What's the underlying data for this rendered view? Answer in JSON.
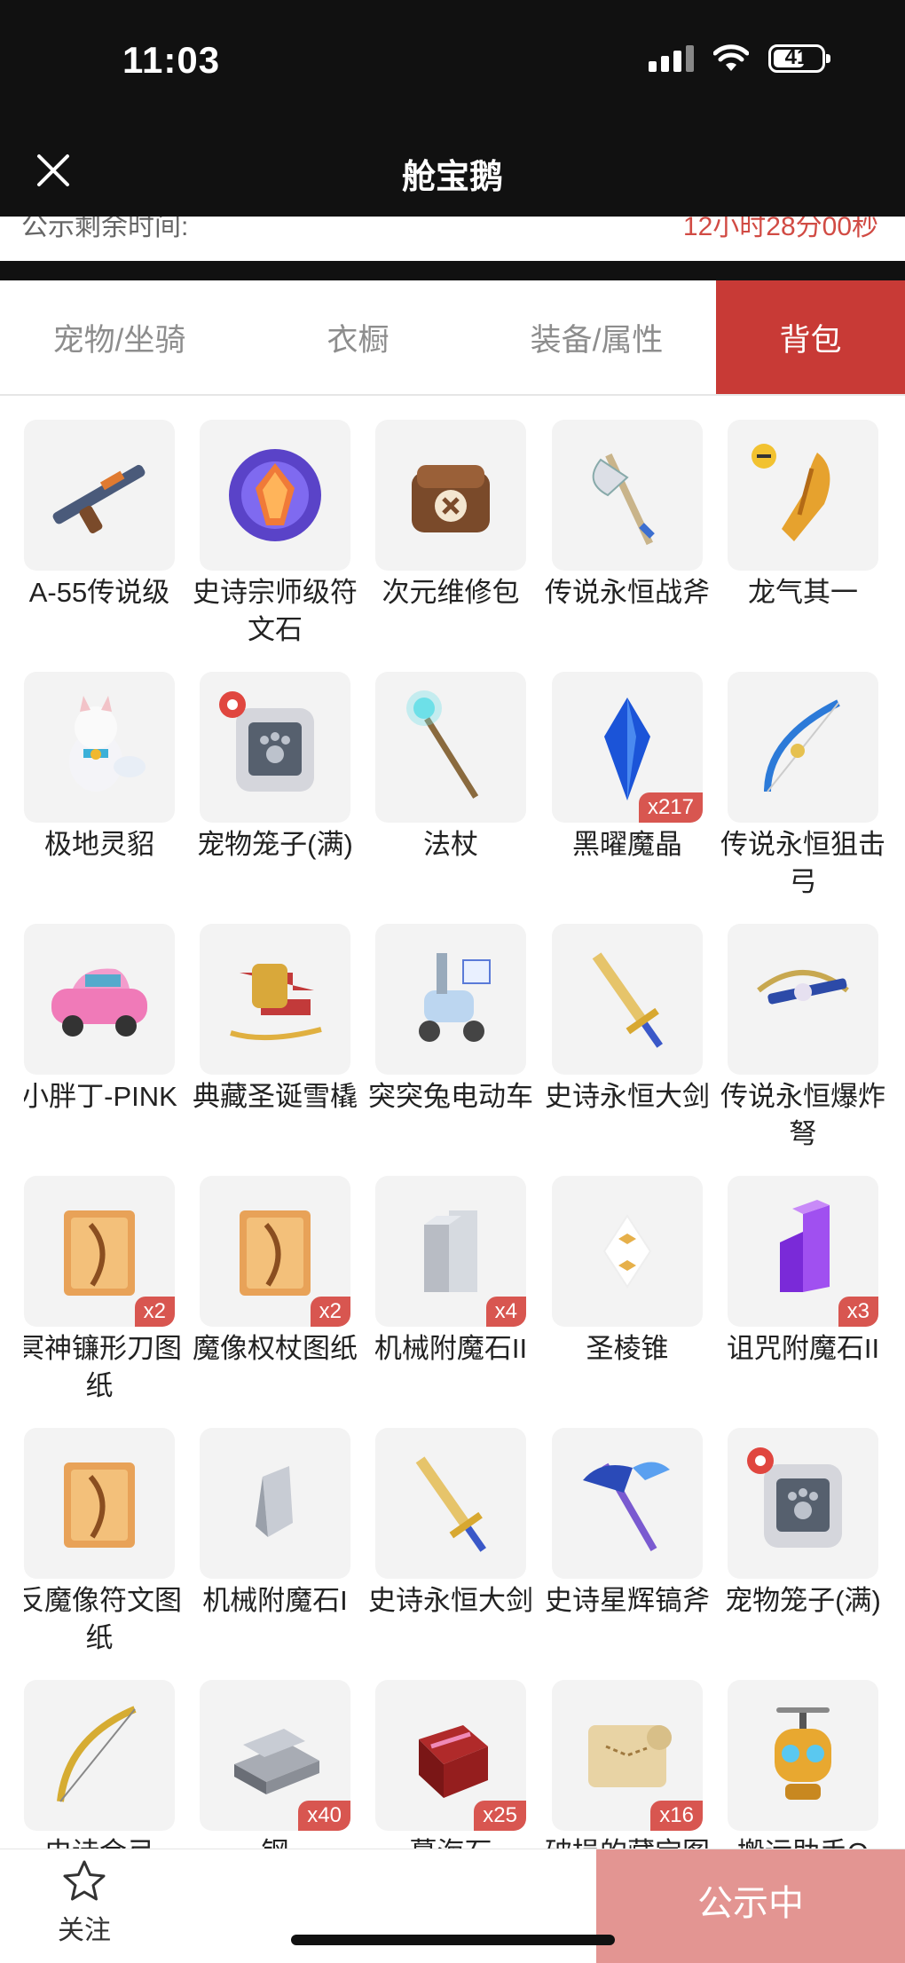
{
  "status_bar": {
    "time": "11:03",
    "battery": "41"
  },
  "nav": {
    "title": "舱宝鹅"
  },
  "peek": {
    "left_text": "公示剩余时间:",
    "right_text": "12小时28分00秒"
  },
  "tabs": [
    {
      "label": "宠物/坐骑",
      "active": false
    },
    {
      "label": "衣橱",
      "active": false
    },
    {
      "label": "装备/属性",
      "active": false
    },
    {
      "label": "背包",
      "active": true
    }
  ],
  "items": [
    {
      "name": "A-55传说级",
      "icon": "rifle-icon",
      "badge": ""
    },
    {
      "name": "史诗宗师级符文石",
      "icon": "rune-stone-icon",
      "badge": ""
    },
    {
      "name": "次元维修包",
      "icon": "repair-bag-icon",
      "badge": ""
    },
    {
      "name": "传说永恒战斧",
      "icon": "battle-axe-icon",
      "badge": ""
    },
    {
      "name": "龙气其一",
      "icon": "dragon-claw-icon",
      "badge": ""
    },
    {
      "name": "极地灵貂",
      "icon": "arctic-marten-icon",
      "badge": ""
    },
    {
      "name": "宠物笼子(满)",
      "icon": "pet-cage-icon",
      "badge": "",
      "pet": true
    },
    {
      "name": "法杖",
      "icon": "staff-icon",
      "badge": ""
    },
    {
      "name": "黑曜魔晶",
      "icon": "crystal-icon",
      "badge": "x217"
    },
    {
      "name": "传说永恒狙击弓",
      "icon": "bow-icon",
      "badge": ""
    },
    {
      "name": "小胖丁-PINK",
      "icon": "pink-car-icon",
      "badge": ""
    },
    {
      "name": "典藏圣诞雪橇",
      "icon": "sleigh-icon",
      "badge": ""
    },
    {
      "name": "突突兔电动车",
      "icon": "scooter-icon",
      "badge": ""
    },
    {
      "name": "史诗永恒大剑",
      "icon": "great-sword-icon",
      "badge": ""
    },
    {
      "name": "传说永恒爆炸弩",
      "icon": "crossbow-icon",
      "badge": ""
    },
    {
      "name": "冥神镰形刀图纸",
      "icon": "blueprint-icon",
      "badge": "x2"
    },
    {
      "name": "魔像权杖图纸",
      "icon": "blueprint-icon",
      "badge": "x2"
    },
    {
      "name": "机械附魔石II",
      "icon": "metal-stone-icon",
      "badge": "x4"
    },
    {
      "name": "圣棱锥",
      "icon": "pyramid-icon",
      "badge": ""
    },
    {
      "name": "诅咒附魔石II",
      "icon": "purple-stone-icon",
      "badge": "x3"
    },
    {
      "name": "反魔像符文图纸",
      "icon": "blueprint-icon",
      "badge": ""
    },
    {
      "name": "机械附魔石I",
      "icon": "metal-shard-icon",
      "badge": ""
    },
    {
      "name": "史诗永恒大剑",
      "icon": "great-sword-icon",
      "badge": ""
    },
    {
      "name": "史诗星辉镐斧",
      "icon": "pick-axe-icon",
      "badge": ""
    },
    {
      "name": "宠物笼子(满)",
      "icon": "pet-cage-icon",
      "badge": "",
      "pet": true
    },
    {
      "name": "史诗金弓",
      "icon": "gold-bow-icon",
      "badge": ""
    },
    {
      "name": "钢",
      "icon": "steel-ingot-icon",
      "badge": "x40"
    },
    {
      "name": "蔓海石",
      "icon": "gift-stone-icon",
      "badge": "x25"
    },
    {
      "name": "破损的藏宝图",
      "icon": "map-scroll-icon",
      "badge": "x16"
    },
    {
      "name": "搬运助手Q",
      "icon": "robot-icon",
      "badge": ""
    }
  ],
  "bottom": {
    "follow_label": "关注",
    "status_button": "公示中"
  },
  "colors": {
    "accent": "#c83a36",
    "badge": "#d85650",
    "status_button": "#e39592"
  }
}
